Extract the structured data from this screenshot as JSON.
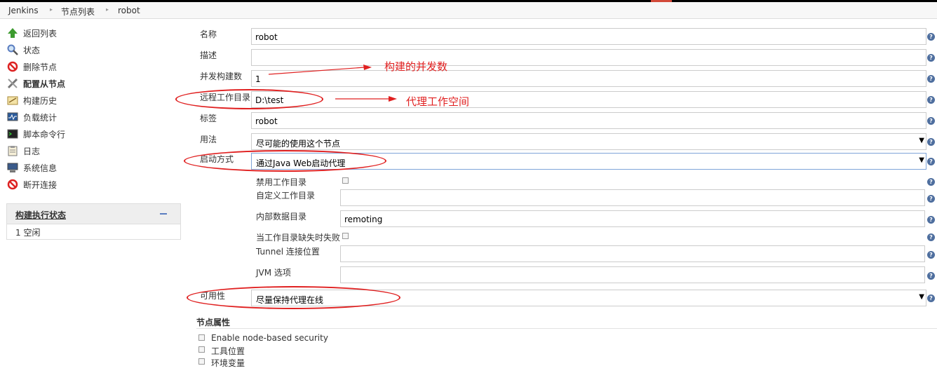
{
  "breadcrumb": [
    "Jenkins",
    "节点列表",
    "robot"
  ],
  "sidebar": {
    "items": [
      {
        "label": "返回列表",
        "icon": "up-arrow-icon"
      },
      {
        "label": "状态",
        "icon": "search-icon"
      },
      {
        "label": "删除节点",
        "icon": "no-entry-icon"
      },
      {
        "label": "配置从节点",
        "icon": "tools-icon",
        "active": true
      },
      {
        "label": "构建历史",
        "icon": "notepad-icon"
      },
      {
        "label": "负载统计",
        "icon": "monitor-chart-icon"
      },
      {
        "label": "脚本命令行",
        "icon": "terminal-icon"
      },
      {
        "label": "日志",
        "icon": "clipboard-icon"
      },
      {
        "label": "系统信息",
        "icon": "computer-icon"
      },
      {
        "label": "断开连接",
        "icon": "no-entry-icon"
      }
    ],
    "executor": {
      "title": "构建执行状态",
      "rows": [
        "1 空闲"
      ]
    }
  },
  "form": {
    "name": {
      "label": "名称",
      "value": "robot"
    },
    "description": {
      "label": "描述",
      "value": ""
    },
    "executors": {
      "label": "并发构建数",
      "value": "1"
    },
    "remote_fs": {
      "label": "远程工作目录",
      "value": "D:\\test"
    },
    "labels": {
      "label": "标签",
      "value": "robot"
    },
    "usage": {
      "label": "用法",
      "value": "尽可能的使用这个节点"
    },
    "launch": {
      "label": "启动方式",
      "value": "通过Java Web启动代理"
    },
    "launch_opts": {
      "disable_workdir": {
        "label": "禁用工作目录",
        "checked": false
      },
      "custom_workdir": {
        "label": "自定义工作目录",
        "value": ""
      },
      "internal_dir": {
        "label": "内部数据目录",
        "value": "remoting"
      },
      "fail_missing": {
        "label": "当工作目录缺失时失败",
        "checked": false
      },
      "tunnel": {
        "label": "Tunnel 连接位置",
        "value": ""
      },
      "jvm": {
        "label": "JVM 选项",
        "value": ""
      }
    },
    "availability": {
      "label": "可用性",
      "value": "尽量保持代理在线"
    }
  },
  "node_properties": {
    "title": "节点属性",
    "items": [
      "Enable node-based security",
      "工具位置",
      "环境变量"
    ]
  },
  "annotations": {
    "executors_note": "构建的并发数",
    "remote_fs_note": "代理工作空间"
  },
  "colors": {
    "annotation": "#e02020",
    "help_icon": "#4f6f9f"
  }
}
